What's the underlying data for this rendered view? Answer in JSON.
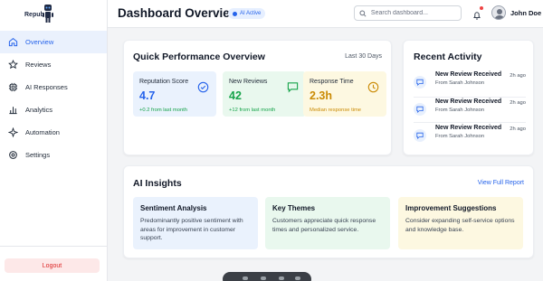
{
  "sidebar": {
    "logo_text": "Repub",
    "items": [
      {
        "label": "Overview",
        "icon": "home-icon",
        "active": true
      },
      {
        "label": "Reviews",
        "icon": "star-icon",
        "active": false
      },
      {
        "label": "AI Responses",
        "icon": "cpu-icon",
        "active": false
      },
      {
        "label": "Analytics",
        "icon": "bar-chart-icon",
        "active": false
      },
      {
        "label": "Automation",
        "icon": "sparkle-icon",
        "active": false
      },
      {
        "label": "Settings",
        "icon": "gear-icon",
        "active": false
      }
    ],
    "logout_label": "Logout"
  },
  "header": {
    "title": "Dashboard Overview",
    "badge": "AI Active",
    "search_placeholder": "Search dashboard...",
    "user_name": "John Doe"
  },
  "performance": {
    "title": "Quick Performance Overview",
    "period": "Last 30 Days",
    "metrics": [
      {
        "label": "Reputation Score",
        "value": "4.7",
        "sub": "+0.2 from last month",
        "icon": "check-circle-icon",
        "color": "#2563eb",
        "sub_color": "#16a34a",
        "bg": "#eaf2fd"
      },
      {
        "label": "New Reviews",
        "value": "42",
        "sub": "+12 from last month",
        "icon": "message-square-icon",
        "color": "#16a34a",
        "sub_color": "#16a34a",
        "bg": "#e9f8ee"
      },
      {
        "label": "Response Time",
        "value": "2.3h",
        "sub": "Median response time",
        "icon": "clock-icon",
        "color": "#ca8a04",
        "sub_color": "#ca8a04",
        "bg": "#fdf8e1"
      }
    ]
  },
  "activity": {
    "title": "Recent Activity",
    "items": [
      {
        "title": "New Review Received",
        "from": "From Sarah Johnson",
        "time": "2h ago"
      },
      {
        "title": "New Review Received",
        "from": "From Sarah Johnson",
        "time": "2h ago"
      },
      {
        "title": "New Review Received",
        "from": "From Sarah Johnson",
        "time": "2h ago"
      }
    ]
  },
  "insights": {
    "title": "AI Insights",
    "link": "View Full Report",
    "boxes": [
      {
        "title": "Sentiment Analysis",
        "text": "Predominantly positive sentiment with areas for improvement in customer support.",
        "bg": "#eaf2fd"
      },
      {
        "title": "Key Themes",
        "text": "Customers appreciate quick response times and personalized service.",
        "bg": "#e9f8ee"
      },
      {
        "title": "Improvement Suggestions",
        "text": "Consider expanding self-service options and knowledge base.",
        "bg": "#fdf8e1"
      }
    ]
  },
  "colors": {
    "accent": "#2563eb",
    "danger": "#dc2626"
  }
}
